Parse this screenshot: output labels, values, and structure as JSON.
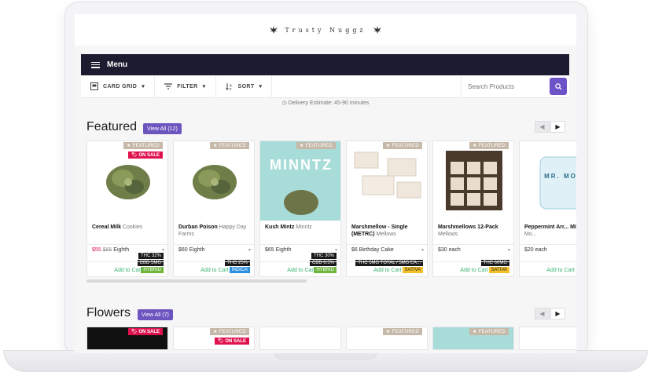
{
  "site": {
    "brand": "Trusty Nuggz"
  },
  "menu": {
    "label": "Menu"
  },
  "toolbar": {
    "view_label": "CARD GRID",
    "filter_label": "FILTER",
    "sort_label": "SORT",
    "search_placeholder": "Search Products"
  },
  "delivery": {
    "text": "Delivery Estimate: 45-90 minutes"
  },
  "featured": {
    "title": "Featured",
    "view_all": "View All (12)",
    "cards": [
      {
        "featured": "FEATURED",
        "sale": "ON SALE",
        "chips": [
          "THC 32%",
          "CBD 5MG",
          "HYBRID"
        ],
        "name": "Cereal Milk",
        "brand": "Cookies",
        "sale_price": "$55",
        "old_price": "$65",
        "unit": "Eighth",
        "add": "Add to Cart",
        "image": "flower"
      },
      {
        "featured": "FEATURED",
        "chips": [
          "THC 25%",
          "INDICA"
        ],
        "name": "Durban Poison",
        "brand": "Happy Day Farms",
        "price": "$60",
        "unit": "Eighth",
        "add": "Add to Cart",
        "image": "flower"
      },
      {
        "featured": "FEATURED",
        "chips": [
          "THC 30%",
          "CBD 0.5%",
          "HYBRID"
        ],
        "name": "Kush Mintz",
        "brand": "Minntz",
        "price": "$65",
        "unit": "Eighth",
        "add": "Add to Cart",
        "image": "minntz",
        "logo_text": "MINNTZ"
      },
      {
        "featured": "FEATURED",
        "chips": [
          "THC 5MG TOTAL / 5MG EA...",
          "SATIVA"
        ],
        "name": "Marshmellow - Single (METRC)",
        "brand": "Mellows",
        "price": "$6",
        "unit": "Birthday Cake",
        "add": "Add to Cart",
        "image": "mellow"
      },
      {
        "featured": "FEATURED",
        "chips": [
          "THC 60MG",
          "SATIVA"
        ],
        "name": "Marshmellows 12-Pack",
        "brand": "Mellows",
        "price": "$30",
        "unit": "each",
        "add": "Add to Cart",
        "image": "box"
      },
      {
        "name": "Peppermint Arr... Mints",
        "brand": "Mr. Mo...",
        "price": "$20",
        "unit": "each",
        "add": "Add to Cart",
        "image": "mint",
        "logo_text": "MR. MO"
      }
    ]
  },
  "flowers": {
    "title": "Flowers",
    "view_all": "View All (7)",
    "cards": [
      {
        "sale": "ON SALE"
      },
      {
        "featured": "FEATURED",
        "sale": "ON SALE"
      },
      {},
      {
        "featured": "FEATURED"
      },
      {
        "featured": "FEATURED"
      },
      {}
    ]
  },
  "colors": {
    "accent": "#6d55c0",
    "menu_bg": "#1d1b2f",
    "sale": "#e0124d",
    "add_to_cart": "#3bb36e",
    "featured_tag": "#c7b9a9"
  }
}
